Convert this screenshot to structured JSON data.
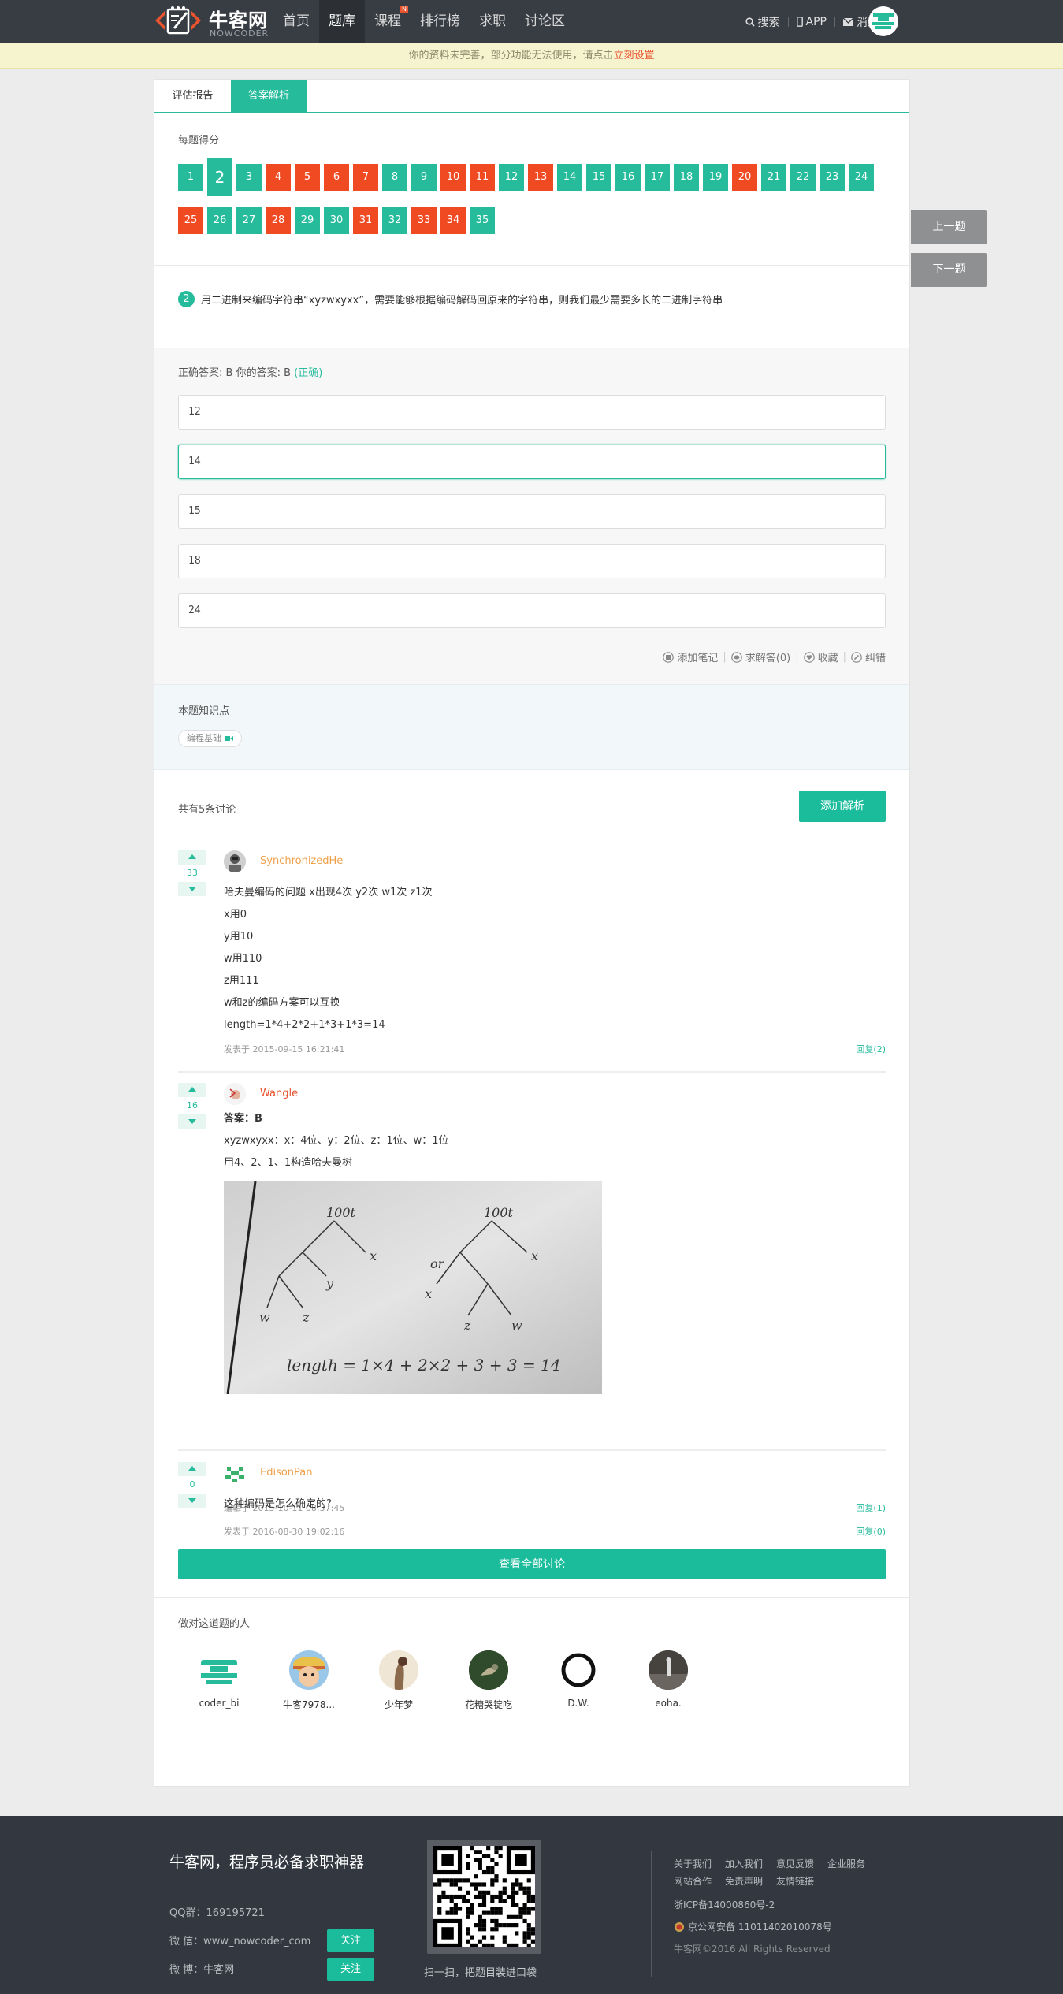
{
  "nav": {
    "logo_cn": "牛客网",
    "logo_en": "NOWCODER",
    "items": [
      {
        "label": "首页"
      },
      {
        "label": "题库"
      },
      {
        "label": "课程",
        "badge": "N"
      },
      {
        "label": "排行榜"
      },
      {
        "label": "求职"
      },
      {
        "label": "讨论区"
      }
    ],
    "search": "搜索",
    "app": "APP",
    "messages": "消息"
  },
  "notice": {
    "text": "你的资料未完善，部分功能无法使用，请点击",
    "link": "立刻设置"
  },
  "tabs": {
    "report": "评估报告",
    "analysis": "答案解析"
  },
  "scores": {
    "label": "每题得分",
    "current": 2,
    "items": [
      {
        "n": "1",
        "ok": true
      },
      {
        "n": "2",
        "ok": true
      },
      {
        "n": "3",
        "ok": true
      },
      {
        "n": "4",
        "ok": false
      },
      {
        "n": "5",
        "ok": false
      },
      {
        "n": "6",
        "ok": false
      },
      {
        "n": "7",
        "ok": false
      },
      {
        "n": "8",
        "ok": true
      },
      {
        "n": "9",
        "ok": true
      },
      {
        "n": "10",
        "ok": false
      },
      {
        "n": "11",
        "ok": false
      },
      {
        "n": "12",
        "ok": true
      },
      {
        "n": "13",
        "ok": false
      },
      {
        "n": "14",
        "ok": true
      },
      {
        "n": "15",
        "ok": true
      },
      {
        "n": "16",
        "ok": true
      },
      {
        "n": "17",
        "ok": true
      },
      {
        "n": "18",
        "ok": true
      },
      {
        "n": "19",
        "ok": true
      },
      {
        "n": "20",
        "ok": false
      },
      {
        "n": "21",
        "ok": true
      },
      {
        "n": "22",
        "ok": true
      },
      {
        "n": "23",
        "ok": true
      },
      {
        "n": "24",
        "ok": true
      },
      {
        "n": "25",
        "ok": false
      },
      {
        "n": "26",
        "ok": true
      },
      {
        "n": "27",
        "ok": true
      },
      {
        "n": "28",
        "ok": false
      },
      {
        "n": "29",
        "ok": true
      },
      {
        "n": "30",
        "ok": true
      },
      {
        "n": "31",
        "ok": false
      },
      {
        "n": "32",
        "ok": true
      },
      {
        "n": "33",
        "ok": false
      },
      {
        "n": "34",
        "ok": false
      },
      {
        "n": "35",
        "ok": true
      }
    ]
  },
  "question": {
    "number": "2",
    "text": "用二进制来编码字符串“xyzwxyxx”，需要能够根据编码解码回原来的字符串，则我们最少需要多长的二进制字符串"
  },
  "answer": {
    "correct_label": "正确答案: B   你的答案: B",
    "result": "(正确)",
    "options": [
      "12",
      "14",
      "15",
      "18",
      "24"
    ],
    "selected_index": 1
  },
  "tools": {
    "note": "添加笔记",
    "ask": "求解答(0)",
    "fav": "收藏",
    "fix": "纠错"
  },
  "knowledge": {
    "title": "本题知识点",
    "tag": "编程基础"
  },
  "discussion": {
    "title": "共有5条讨论",
    "add_button": "添加解析",
    "view_all": "查看全部讨论",
    "comments": [
      {
        "votes": "33",
        "user": "SynchronizedHe",
        "user_color": "#f0a04b",
        "lines": [
          "哈夫曼编码的问题 x出现4次 y2次 w1次 z1次",
          "x用0",
          "y用10",
          "w用110",
          "z用111",
          "w和z的编码方案可以互换",
          "length=1*4+2*2+1*3+1*3=14"
        ],
        "meta": "发表于 2015-09-15 16:21:41",
        "reply": "回复(2)"
      },
      {
        "votes": "16",
        "user": "Wangle",
        "user_color": "#e9542f",
        "lines": [
          "答案：B",
          "xyzwxyxx：x：4位、y：2位、z：1位、w：1位",
          "用4、2、1、1构造哈夫曼树"
        ],
        "image_text": "length = 1×4 + 2×2 + 3 + 3 = 14",
        "meta": "编辑于 2015-10-11 08:37:45",
        "reply": "回复(1)"
      },
      {
        "votes": "0",
        "user": "EdisonPan",
        "user_color": "#f0a04b",
        "lines": [
          "这种编码是怎么确定的?"
        ],
        "meta": "发表于 2016-08-30 19:02:16",
        "reply": "回复(0)"
      }
    ]
  },
  "people": {
    "title": "做对这道题的人",
    "users": [
      "coder_bi",
      "牛客7978...",
      "少年梦",
      "花糖哭锭吃",
      "D.W.",
      "eoha."
    ]
  },
  "side": {
    "prev": "上一题",
    "next": "下一题"
  },
  "footer": {
    "slogan": "牛客网，程序员必备求职神器",
    "qq": "QQ群：169195721",
    "wechat": "微 信：www_nowcoder_com",
    "weibo": "微 博：牛客网",
    "follow": "关注",
    "qr_caption": "扫一扫，把题目装进口袋",
    "links1": [
      "关于我们",
      "加入我们",
      "意见反馈",
      "企业服务"
    ],
    "links2": [
      "网站合作",
      "免责声明",
      "友情链接"
    ],
    "icp": "浙ICP备14000860号-2",
    "police": "京公网安备 11011402010078号",
    "copyright": "牛客网©2016 All Rights Reserved"
  },
  "colors": {
    "accent": "#25bb9b",
    "wrong": "#f04a23",
    "nav": "#383c43"
  }
}
